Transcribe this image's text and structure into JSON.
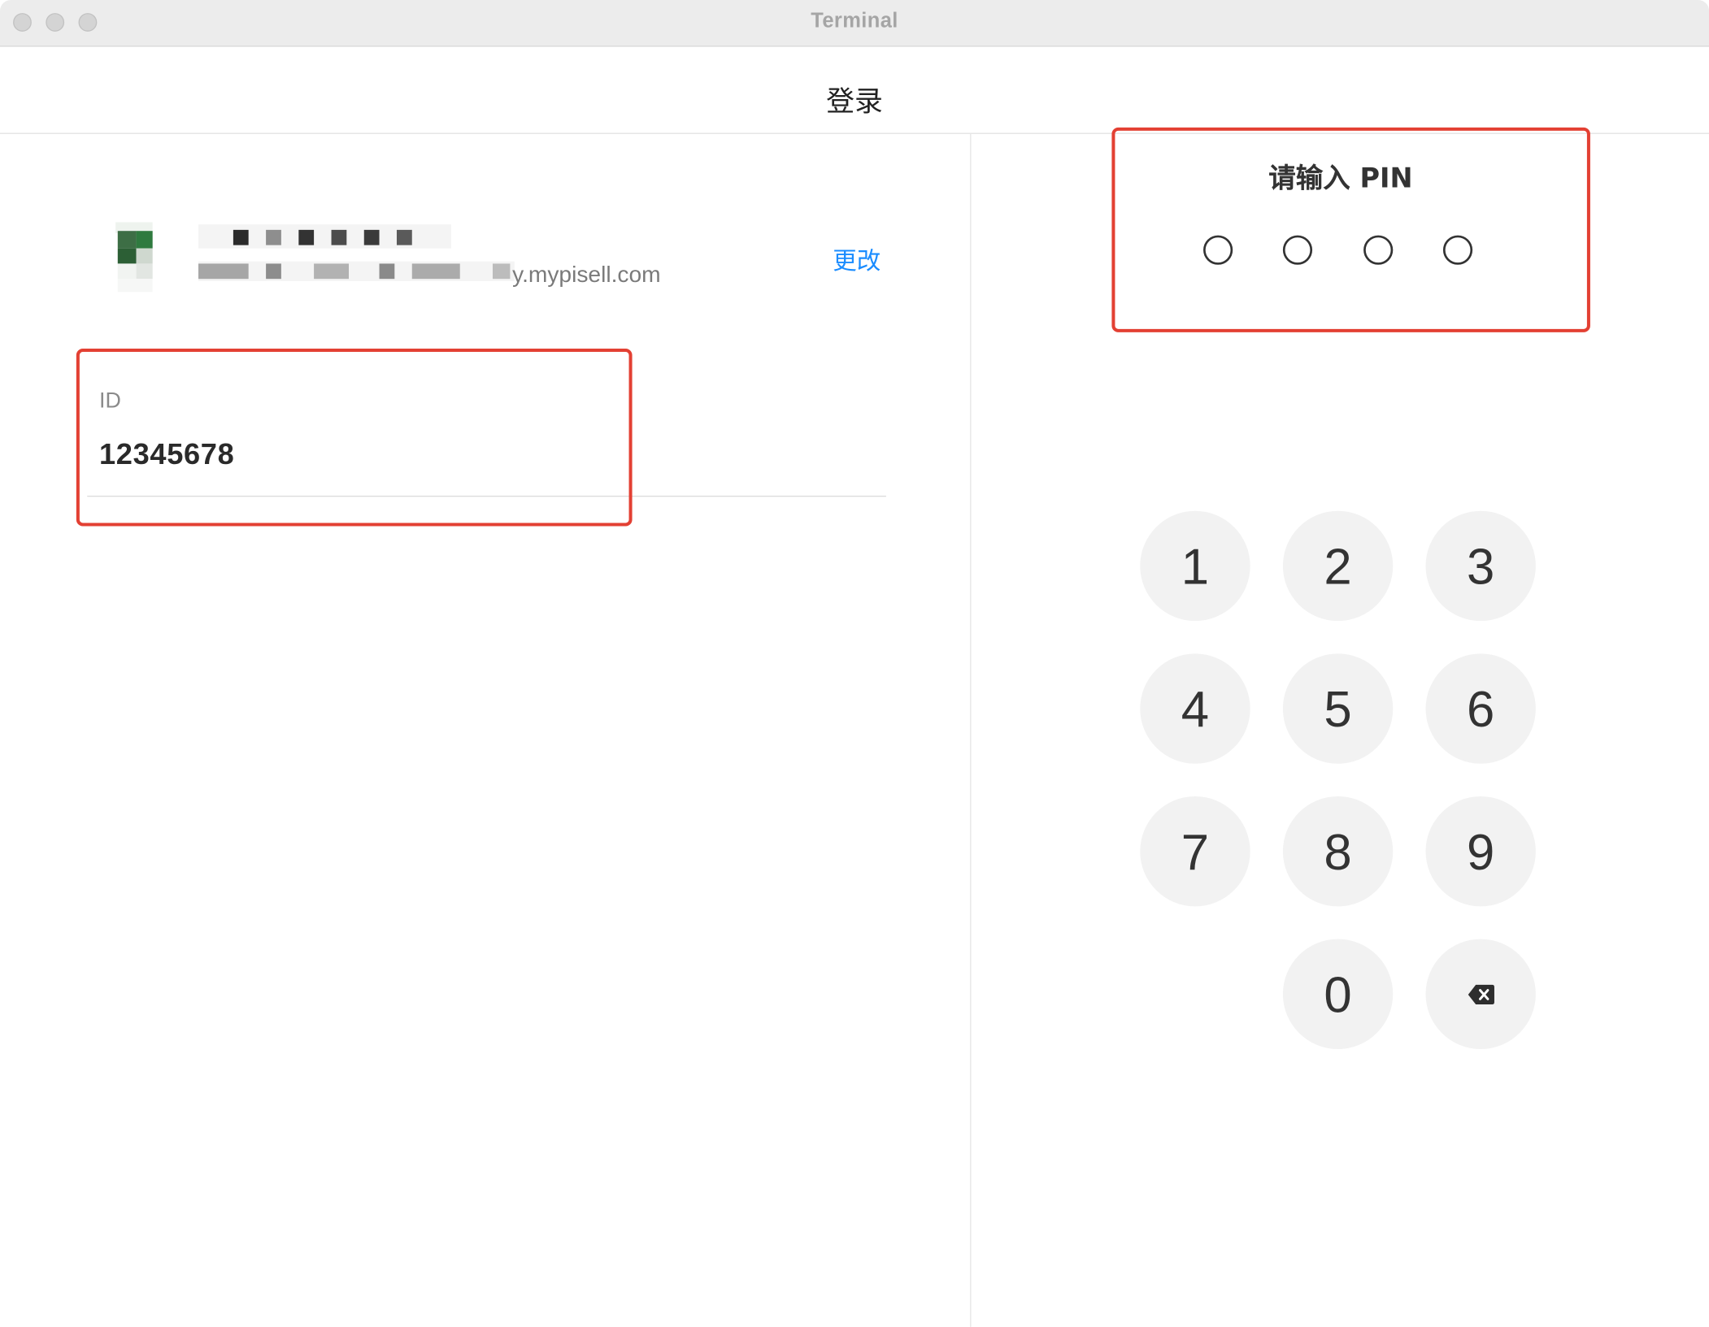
{
  "window": {
    "title": "Terminal"
  },
  "header": {
    "title": "登录"
  },
  "store": {
    "url_visible": "y.mypisell.com",
    "change_label": "更改"
  },
  "id_field": {
    "label": "ID",
    "value": "12345678"
  },
  "pin": {
    "title": "请输入 PIN",
    "entered_count": 0,
    "length": 4
  },
  "keypad": {
    "keys": [
      "1",
      "2",
      "3",
      "4",
      "5",
      "6",
      "7",
      "8",
      "9",
      "0"
    ],
    "backspace_icon": "backspace-icon"
  },
  "colors": {
    "link": "#1a8cff",
    "annotation": "#e34033",
    "key_background": "#f2f2f2"
  }
}
